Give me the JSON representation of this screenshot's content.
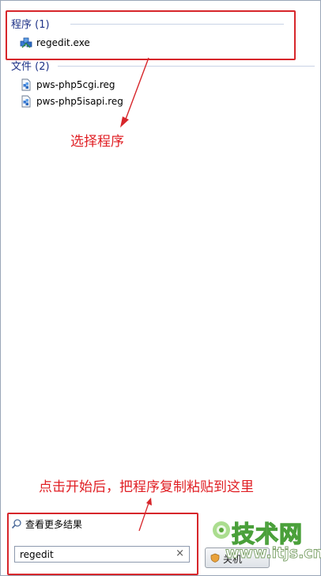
{
  "results": {
    "programs_header": "程序 (1)",
    "programs": [
      {
        "label": "regedit.exe",
        "icon": "registry-editor-icon"
      }
    ],
    "files_header": "文件 (2)",
    "files": [
      {
        "label": "pws-php5cgi.reg",
        "icon": "reg-file-icon"
      },
      {
        "label": "pws-php5isapi.reg",
        "icon": "reg-file-icon"
      }
    ]
  },
  "annotations": {
    "select_program": "选择程序",
    "paste_instruction": "点击开始后，把程序复制粘贴到这里",
    "color": "#e01f24"
  },
  "footer": {
    "see_more": "查看更多结果",
    "search_value": "regedit",
    "clear_symbol": "×",
    "shutdown_label": "关机"
  },
  "watermark": {
    "text": "技术网",
    "url": "www.itjs.cn"
  },
  "colors": {
    "group_header": "#1e3287",
    "panel_border": "#9aa6b8",
    "annotation_red": "#d7262b"
  }
}
